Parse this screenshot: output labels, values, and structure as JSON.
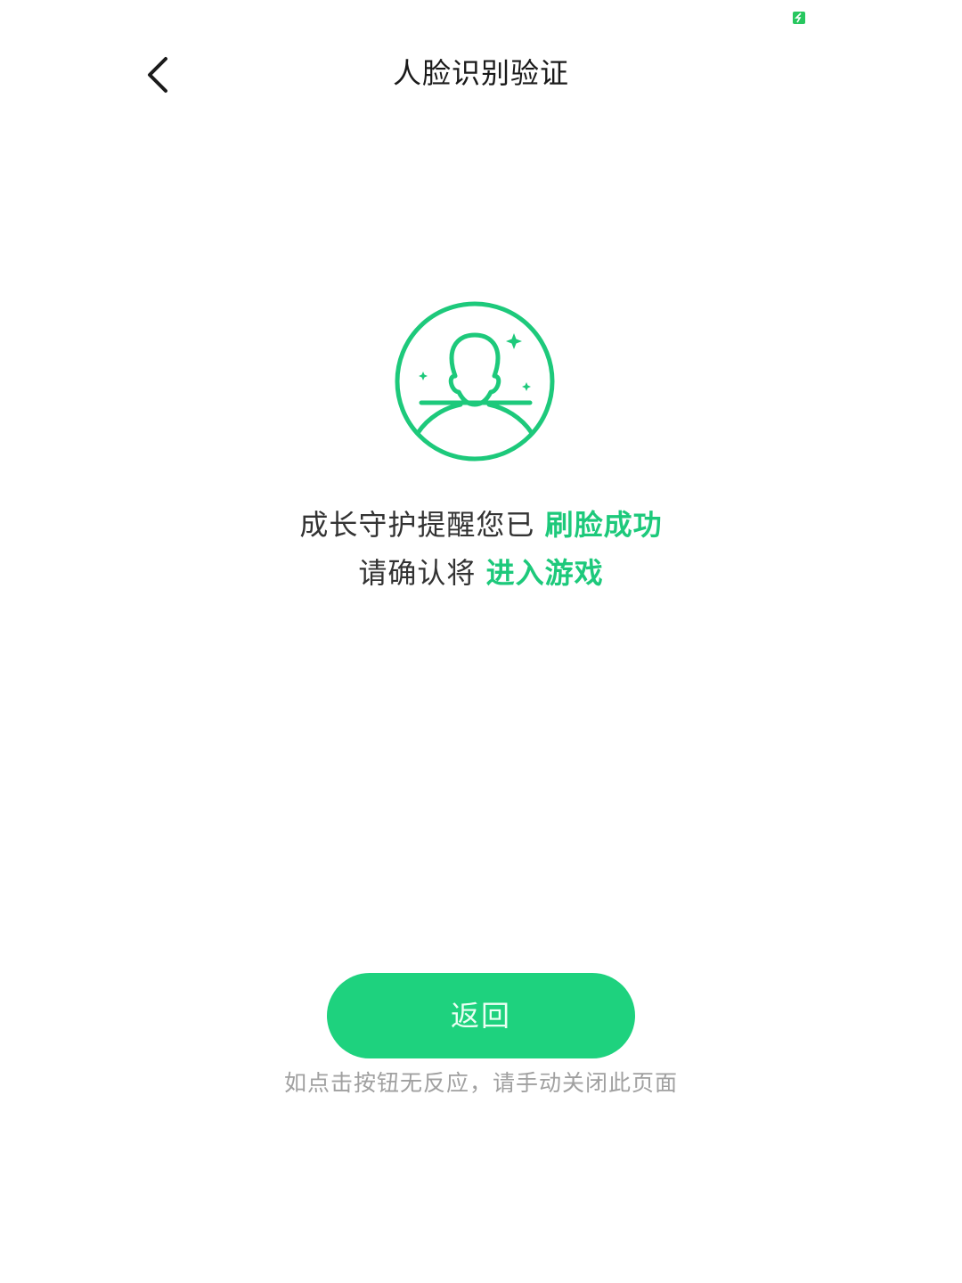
{
  "status_bar": {
    "indicator_icon": "battery-charging-icon",
    "indicator_color": "#27c75f"
  },
  "header": {
    "title": "人脸识别验证",
    "back_icon": "chevron-left-icon"
  },
  "illustration": {
    "icon": "face-scan-icon",
    "color": "#1dc97b"
  },
  "message": {
    "line1_prefix": "成长守护提醒您已",
    "line1_highlight": "刷脸成功",
    "line2_prefix": "请确认将",
    "line2_highlight": "进入游戏",
    "highlight_color": "#1dc97b"
  },
  "actions": {
    "return_label": "返回",
    "button_color": "#1ed27e"
  },
  "hint": {
    "text": "如点击按钮无反应，请手动关闭此页面"
  }
}
